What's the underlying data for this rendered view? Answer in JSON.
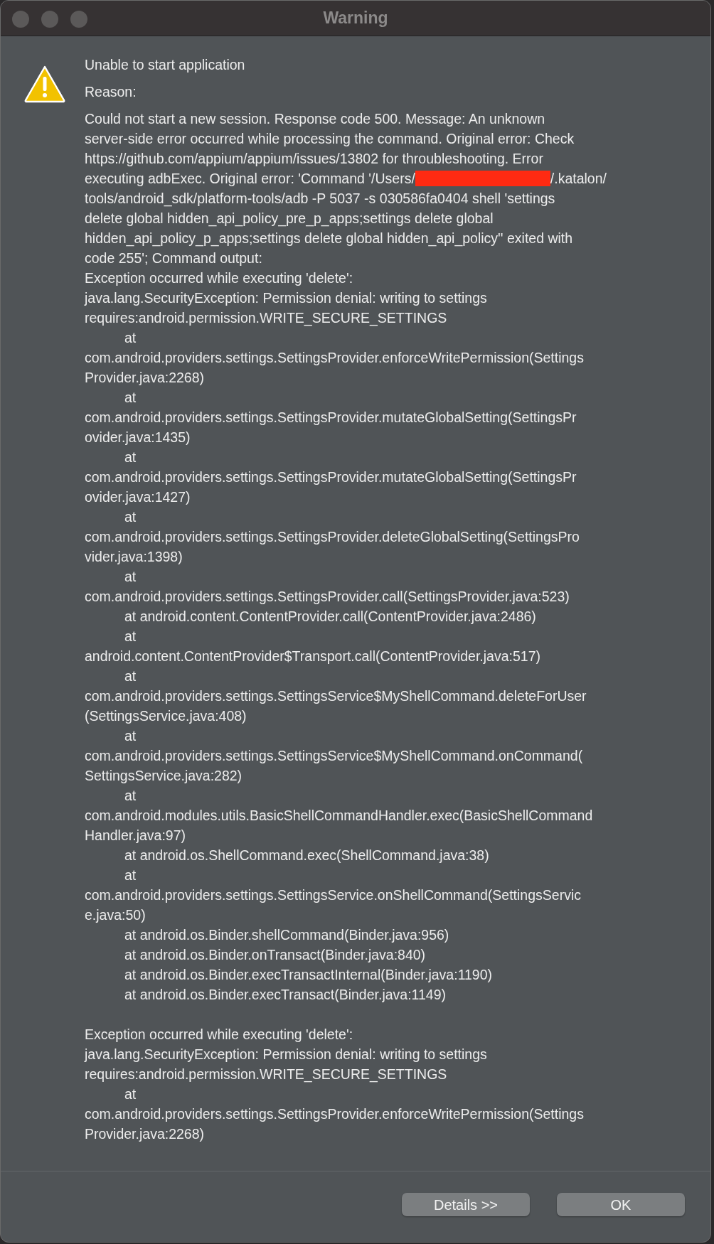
{
  "window": {
    "title": "Warning"
  },
  "heading": "Unable to start application",
  "reason_label": "Reason:",
  "message": [
    {
      "kind": "line",
      "text": "Could not start a new session. Response code 500. Message: An unknown"
    },
    {
      "kind": "line",
      "text": "server-side error occurred while processing the command. Original error: Check"
    },
    {
      "kind": "line",
      "text": "https://github.com/appium/appium/issues/13802 for throubleshooting. Error"
    },
    {
      "kind": "redacted",
      "text": "executing adbExec. Original error: 'Command '/Users/",
      "after": "/.katalon/"
    },
    {
      "kind": "line",
      "text": "tools/android_sdk/platform-tools/adb -P 5037 -s 030586fa0404 shell 'settings"
    },
    {
      "kind": "line",
      "text": "delete global hidden_api_policy_pre_p_apps;settings delete global"
    },
    {
      "kind": "line",
      "text": "hidden_api_policy_p_apps;settings delete global hidden_api_policy'' exited with"
    },
    {
      "kind": "line",
      "text": "code 255'; Command output:"
    },
    {
      "kind": "line",
      "text": "Exception occurred while executing 'delete':"
    },
    {
      "kind": "line",
      "text": "java.lang.SecurityException: Permission denial: writing to settings"
    },
    {
      "kind": "line",
      "text": "requires:android.permission.WRITE_SECURE_SETTINGS"
    },
    {
      "kind": "indented",
      "text": "at"
    },
    {
      "kind": "line",
      "text": "com.android.providers.settings.SettingsProvider.enforceWritePermission(Settings"
    },
    {
      "kind": "line",
      "text": "Provider.java:2268)"
    },
    {
      "kind": "indented",
      "text": "at"
    },
    {
      "kind": "line",
      "text": "com.android.providers.settings.SettingsProvider.mutateGlobalSetting(SettingsPr"
    },
    {
      "kind": "line",
      "text": "ovider.java:1435)"
    },
    {
      "kind": "indented",
      "text": "at"
    },
    {
      "kind": "line",
      "text": "com.android.providers.settings.SettingsProvider.mutateGlobalSetting(SettingsPr"
    },
    {
      "kind": "line",
      "text": "ovider.java:1427)"
    },
    {
      "kind": "indented",
      "text": "at"
    },
    {
      "kind": "line",
      "text": "com.android.providers.settings.SettingsProvider.deleteGlobalSetting(SettingsPro"
    },
    {
      "kind": "line",
      "text": "vider.java:1398)"
    },
    {
      "kind": "indented",
      "text": "at"
    },
    {
      "kind": "line",
      "text": "com.android.providers.settings.SettingsProvider.call(SettingsProvider.java:523)"
    },
    {
      "kind": "indented",
      "text": "at android.content.ContentProvider.call(ContentProvider.java:2486)"
    },
    {
      "kind": "indented",
      "text": "at"
    },
    {
      "kind": "line",
      "text": "android.content.ContentProvider$Transport.call(ContentProvider.java:517)"
    },
    {
      "kind": "indented",
      "text": "at"
    },
    {
      "kind": "line",
      "text": "com.android.providers.settings.SettingsService$MyShellCommand.deleteForUser"
    },
    {
      "kind": "line",
      "text": "(SettingsService.java:408)"
    },
    {
      "kind": "indented",
      "text": "at"
    },
    {
      "kind": "line",
      "text": "com.android.providers.settings.SettingsService$MyShellCommand.onCommand("
    },
    {
      "kind": "line",
      "text": "SettingsService.java:282)"
    },
    {
      "kind": "indented",
      "text": "at"
    },
    {
      "kind": "line",
      "text": "com.android.modules.utils.BasicShellCommandHandler.exec(BasicShellCommand"
    },
    {
      "kind": "line",
      "text": "Handler.java:97)"
    },
    {
      "kind": "indented",
      "text": "at android.os.ShellCommand.exec(ShellCommand.java:38)"
    },
    {
      "kind": "indented",
      "text": "at"
    },
    {
      "kind": "line",
      "text": "com.android.providers.settings.SettingsService.onShellCommand(SettingsServic"
    },
    {
      "kind": "line",
      "text": "e.java:50)"
    },
    {
      "kind": "indented",
      "text": "at android.os.Binder.shellCommand(Binder.java:956)"
    },
    {
      "kind": "indented",
      "text": "at android.os.Binder.onTransact(Binder.java:840)"
    },
    {
      "kind": "indented",
      "text": "at android.os.Binder.execTransactInternal(Binder.java:1190)"
    },
    {
      "kind": "indented",
      "text": "at android.os.Binder.execTransact(Binder.java:1149)"
    },
    {
      "kind": "gap"
    },
    {
      "kind": "line",
      "text": "Exception occurred while executing 'delete':"
    },
    {
      "kind": "line",
      "text": "java.lang.SecurityException: Permission denial: writing to settings"
    },
    {
      "kind": "line",
      "text": "requires:android.permission.WRITE_SECURE_SETTINGS"
    },
    {
      "kind": "indented",
      "text": "at"
    },
    {
      "kind": "line",
      "text": "com.android.providers.settings.SettingsProvider.enforceWritePermission(Settings"
    },
    {
      "kind": "line",
      "text": "Provider.java:2268)"
    }
  ],
  "buttons": [
    "Details >>",
    "OK"
  ]
}
